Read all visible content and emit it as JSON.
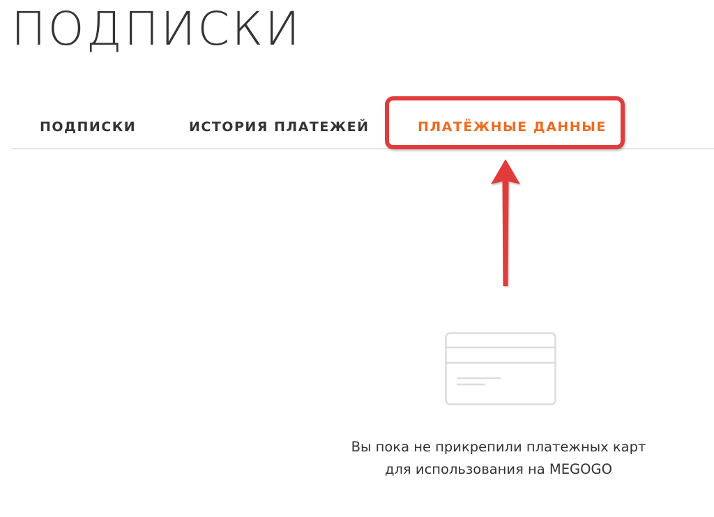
{
  "page": {
    "title": "ПОДПИСКИ"
  },
  "tabs": [
    {
      "label": "ПОДПИСКИ",
      "active": false
    },
    {
      "label": "ИСТОРИЯ ПЛАТЕЖЕЙ",
      "active": false
    },
    {
      "label": "ПЛАТЁЖНЫЕ ДАННЫЕ",
      "active": true
    }
  ],
  "empty_state": {
    "icon": "credit-card-icon",
    "line1": "Вы пока не прикрепили платежных карт",
    "line2": "для использования на MEGOGO"
  },
  "annotation": {
    "highlight_target": "ПЛАТЁЖНЫЕ ДАННЫЕ",
    "color": "#e23b3b"
  },
  "colors": {
    "active_tab": "#ef6b21",
    "text": "#333333",
    "divider": "#e4e4e4"
  }
}
